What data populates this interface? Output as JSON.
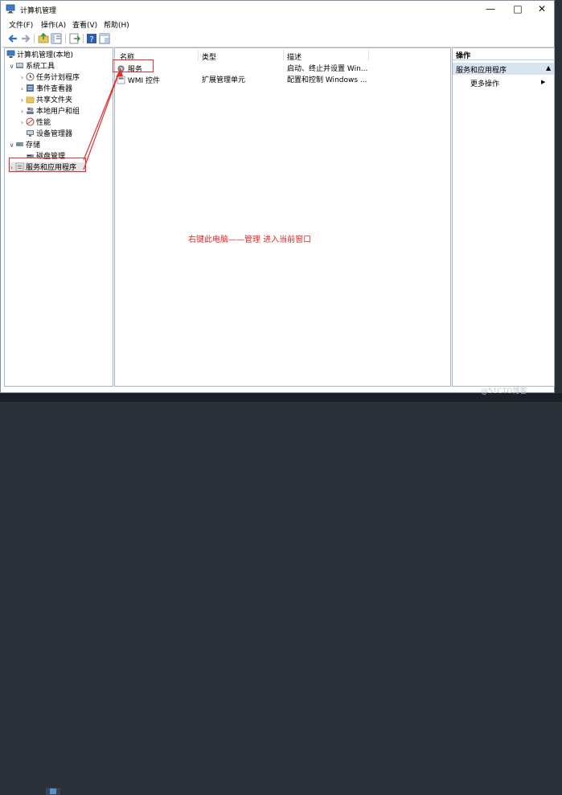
{
  "window": {
    "title": "计算机管理",
    "minimize_label": "—",
    "maximize_label": "□",
    "close_label": "✕"
  },
  "menu": {
    "items": [
      "文件(F)",
      "操作(A)",
      "查看(V)",
      "帮助(H)"
    ]
  },
  "toolbar": {
    "buttons": [
      "back-icon",
      "forward-icon",
      "up-icon",
      "show-hide-tree-icon",
      "export-icon",
      "help-icon",
      "properties-icon"
    ]
  },
  "tree": {
    "root": "计算机管理(本地)",
    "items": [
      {
        "label": "系统工具",
        "expander": "∨"
      },
      {
        "label": "任务计划程序",
        "expander": "›"
      },
      {
        "label": "事件查看器",
        "expander": "›"
      },
      {
        "label": "共享文件夹",
        "expander": "›"
      },
      {
        "label": "本地用户和组",
        "expander": "›"
      },
      {
        "label": "性能",
        "expander": "›"
      },
      {
        "label": "设备管理器",
        "expander": ""
      },
      {
        "label": "存储",
        "expander": "∨"
      },
      {
        "label": "磁盘管理",
        "expander": ""
      },
      {
        "label": "服务和应用程序",
        "expander": "›"
      }
    ]
  },
  "list": {
    "columns": [
      "名称",
      "类型",
      "描述"
    ],
    "rows": [
      {
        "name": "服务",
        "type": "",
        "desc": "启动、终止并设置 Win..."
      },
      {
        "name": "WMI 控件",
        "type": "扩展管理单元",
        "desc": "配置和控制 Windows ..."
      }
    ]
  },
  "actions": {
    "header": "操作",
    "section": "服务和应用程序",
    "section_arrow": "▲",
    "more": "更多操作",
    "more_arrow": "▶"
  },
  "annotation": "右键此电脑——管理 进入当前窗口",
  "watermark": "@51CTO博客",
  "colors": {
    "accent": "#d9e4f1",
    "annotation": "#e02828",
    "border": "#a9b4c2"
  }
}
